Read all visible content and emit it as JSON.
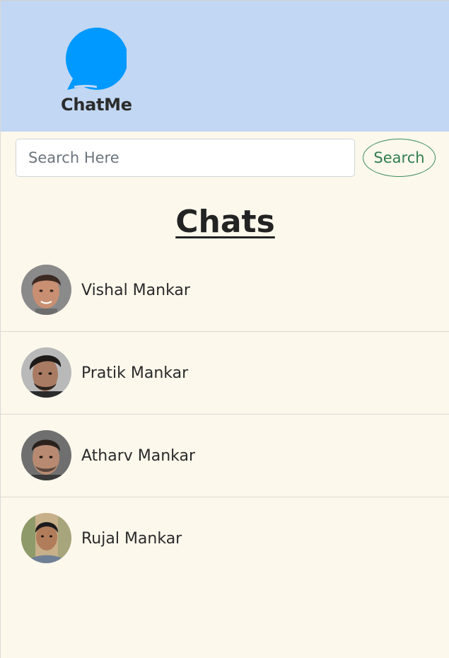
{
  "header": {
    "app_name": "ChatMe",
    "logo_icon": "chat-bubble-icon",
    "logo_color": "#0099ff",
    "background": "#c2d7f3"
  },
  "search": {
    "placeholder": "Search Here",
    "value": "",
    "button_label": "Search",
    "button_color": "#2f7d4e"
  },
  "chats": {
    "title": "Chats",
    "items": [
      {
        "name": "Vishal Mankar",
        "avatar": "user-photo"
      },
      {
        "name": "Pratik Mankar",
        "avatar": "user-photo"
      },
      {
        "name": "Atharv Mankar",
        "avatar": "user-photo"
      },
      {
        "name": "Rujal Mankar",
        "avatar": "user-photo"
      }
    ]
  }
}
